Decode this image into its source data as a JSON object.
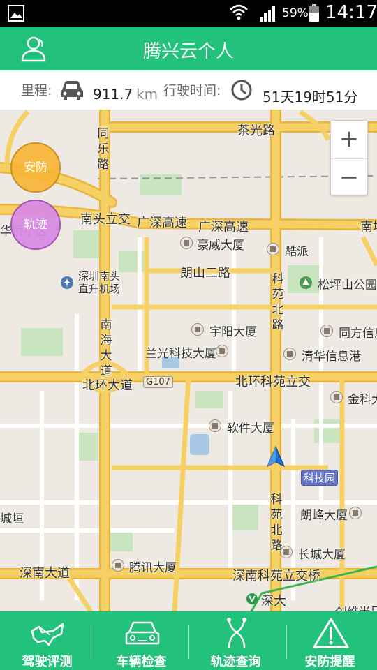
{
  "status_bar": {
    "battery": "59%",
    "time": "14:17",
    "icons": [
      "picture-icon",
      "wifi-icon",
      "signal-icon",
      "battery-icon"
    ]
  },
  "header": {
    "title": "腾兴云个人",
    "left_icon": "user-icon"
  },
  "stats": {
    "mileage_label": "里程:",
    "mileage_value": "911.7",
    "mileage_unit": "km",
    "drive_time_label": "行驶时间:",
    "drive_time_value": "51天19时51分"
  },
  "map": {
    "zoom_in": "+",
    "zoom_out": "−",
    "overlay_buttons": {
      "security": "安防",
      "track": "轨迹"
    },
    "labels": {
      "chaguang_road": "茶光路",
      "tongle_road": "同乐路",
      "nantou_interchange": "南头立交",
      "guangshen_1": "广深高速",
      "guangshen_2": "广深高速",
      "nanping_edge": "南坪",
      "haowei": "豪威大厦",
      "kupai": "酷派",
      "langshan2": "朗山二路",
      "songpingshan": "松坪山公园",
      "airport": "深圳南头直升机场",
      "kejibei_road_1": "科苑北路",
      "nanhai": "南海大道",
      "yuyang": "宇阳大厦",
      "tongfang": "同方信息",
      "languang": "兰光科技大厦",
      "tsinghua": "清华信息港",
      "beihuan": "北环大道",
      "g107": "G107",
      "beihuan_keyuan": "北环科苑立交",
      "jinke": "金科大",
      "software": "软件大厦",
      "kejiyuan": "科技园",
      "chengyuan": "城垣",
      "langfeng": "朗峰大厦",
      "kejibei_road_2": "科苑北路",
      "changcheng": "长城大厦",
      "shennan": "深南大道",
      "tencent": "腾讯大厦",
      "shennan_keyuan": "深南科苑立交桥",
      "shenda": "深大",
      "chuangwei": "创维半导",
      "huaqiao_edge": "华侨小区"
    }
  },
  "bottom_nav": [
    {
      "label": "驾驶评测",
      "icon": "steering-plane-icon"
    },
    {
      "label": "车辆检查",
      "icon": "car-front-icon"
    },
    {
      "label": "轨迹查询",
      "icon": "route-icon"
    },
    {
      "label": "安防提醒",
      "icon": "warning-icon"
    }
  ],
  "colors": {
    "brand_green": "#22c17c",
    "road_yellow": "#f6d064",
    "map_bg": "#eeeae3"
  }
}
